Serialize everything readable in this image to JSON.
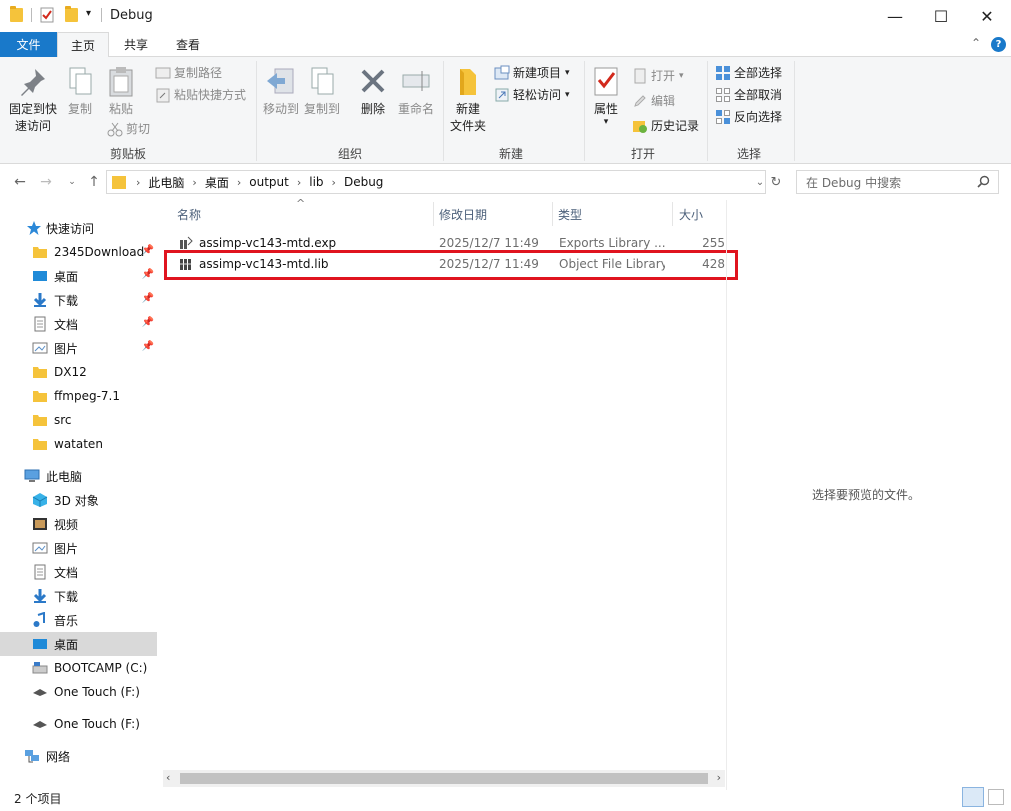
{
  "window": {
    "title": "Debug",
    "controls": {
      "minimize": "—",
      "maximize": "☐",
      "close": "✕"
    }
  },
  "ribbon": {
    "tabs": [
      "文件",
      "主页",
      "共享",
      "查看"
    ],
    "active_tab": "主页",
    "clipboard": {
      "label": "剪贴板",
      "pin": "固定到快\n速访问",
      "pin_l1": "固定到快",
      "pin_l2": "速访问",
      "copy": "复制",
      "paste": "粘贴",
      "copy_path": "复制路径",
      "paste_shortcut": "粘贴快捷方式",
      "cut": "剪切"
    },
    "organize": {
      "label": "组织",
      "move_to": "移动到",
      "copy_to": "复制到",
      "delete": "删除",
      "rename": "重命名"
    },
    "new": {
      "label": "新建",
      "new_folder_l1": "新建",
      "new_folder_l2": "文件夹",
      "new_item": "新建项目",
      "easy_access": "轻松访问"
    },
    "open": {
      "label": "打开",
      "properties": "属性",
      "open": "打开",
      "edit": "编辑",
      "history": "历史记录"
    },
    "select": {
      "label": "选择",
      "select_all": "全部选择",
      "select_none": "全部取消",
      "invert": "反向选择"
    }
  },
  "address": {
    "crumbs": [
      "此电脑",
      "桌面",
      "output",
      "lib",
      "Debug"
    ],
    "search_placeholder": "在 Debug 中搜索"
  },
  "sidebar": {
    "quick_access": "快速访问",
    "quick_items": [
      {
        "label": "2345Download",
        "pinned": true
      },
      {
        "label": "桌面",
        "pinned": true
      },
      {
        "label": "下载",
        "pinned": true
      },
      {
        "label": "文档",
        "pinned": true
      },
      {
        "label": "图片",
        "pinned": true
      },
      {
        "label": "DX12",
        "pinned": false
      },
      {
        "label": "ffmpeg-7.1",
        "pinned": false
      },
      {
        "label": "src",
        "pinned": false
      },
      {
        "label": "wataten",
        "pinned": false
      }
    ],
    "this_pc": "此电脑",
    "pc_items": [
      "3D 对象",
      "视频",
      "图片",
      "文档",
      "下载",
      "音乐",
      "桌面",
      "BOOTCAMP (C:)",
      "One Touch (F:)"
    ],
    "selected": "桌面",
    "drive": "One Touch (F:)",
    "network": "网络"
  },
  "filelist": {
    "columns": [
      "名称",
      "修改日期",
      "类型",
      "大小"
    ],
    "files": [
      {
        "name": "assimp-vc143-mtd.exp",
        "date": "2025/12/7 11:49",
        "type": "Exports Library ...",
        "size": "255"
      },
      {
        "name": "assimp-vc143-mtd.lib",
        "date": "2025/12/7 11:49",
        "type": "Object File Library",
        "size": "428"
      }
    ]
  },
  "preview": {
    "text": "选择要预览的文件。"
  },
  "status": {
    "count": "2 个项目"
  },
  "colors": {
    "accent": "#1979ca",
    "highlight": "#e0141f",
    "folder": "#f5c33b"
  }
}
